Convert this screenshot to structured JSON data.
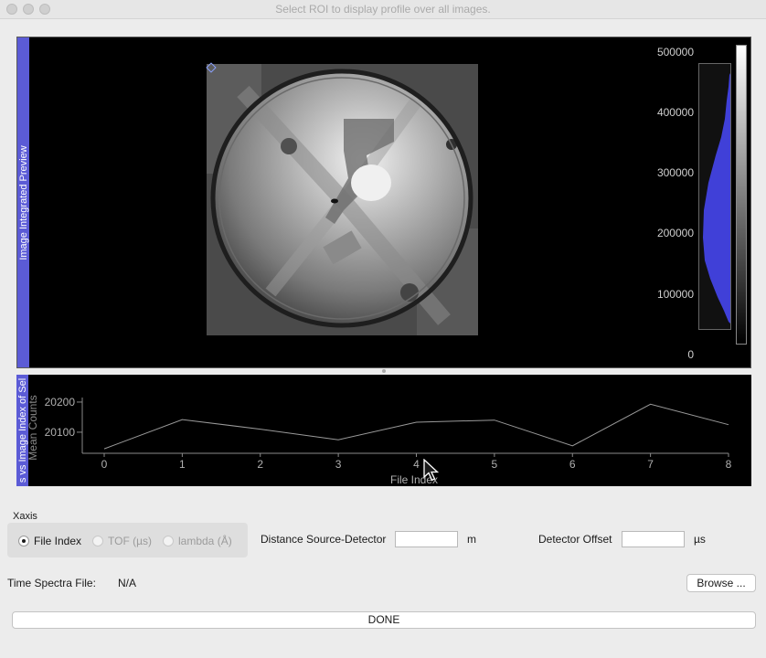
{
  "window": {
    "title": "Select ROI to display profile over all images."
  },
  "preview": {
    "tab_label": "Image Integrated Preview",
    "histogram_ticks": [
      "500000",
      "400000",
      "300000",
      "200000",
      "100000",
      "0"
    ]
  },
  "profile": {
    "tab_label": "s vs Image Index of Sel",
    "ylabel": "Mean Counts",
    "xlabel": "File Index"
  },
  "chart_data": {
    "type": "line",
    "x": [
      0,
      1,
      2,
      3,
      4,
      5,
      6,
      7,
      8
    ],
    "y": [
      20045,
      20142,
      20110,
      20075,
      20133,
      20140,
      20055,
      20193,
      20125
    ],
    "xlabel": "File Index",
    "ylabel": "Mean Counts",
    "xlim": [
      0,
      8
    ],
    "ylim": [
      20030,
      20215
    ],
    "xticks": [
      "0",
      "1",
      "2",
      "3",
      "4",
      "5",
      "6",
      "7",
      "8"
    ],
    "yticks": [
      20100,
      20200
    ],
    "ytick_labels": [
      "20100",
      "20200"
    ],
    "grid": false,
    "colors": {
      "line": "#9a9a9a",
      "axis": "#8a8a8a",
      "background": "#000000"
    }
  },
  "xaxis": {
    "title": "Xaxis",
    "options": [
      {
        "label": "File Index",
        "checked": true,
        "enabled": true
      },
      {
        "label": "TOF (µs)",
        "checked": false,
        "enabled": false
      },
      {
        "label": "lambda (Å)",
        "checked": false,
        "enabled": false
      }
    ]
  },
  "distance": {
    "label": "Distance Source-Detector",
    "value": "",
    "unit": "m"
  },
  "offset": {
    "label": "Detector Offset",
    "value": "",
    "unit": "µs"
  },
  "time_spectra": {
    "label": "Time Spectra File:",
    "value": "N/A",
    "browse_label": "Browse ..."
  },
  "done_label": "DONE",
  "colors": {
    "tab": "#5b5bd6",
    "histogram_fill": "#4040d8"
  }
}
